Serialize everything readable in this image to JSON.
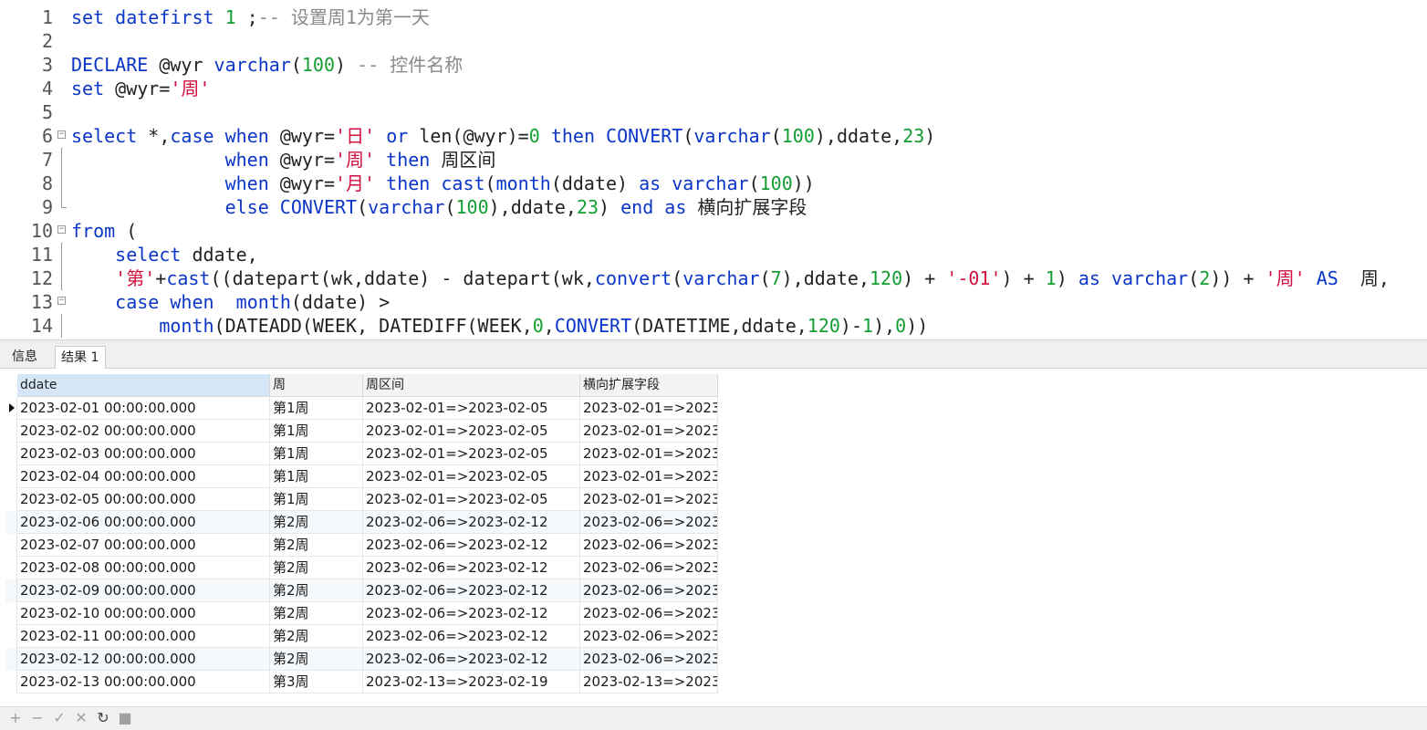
{
  "editor": {
    "lines": [
      {
        "num": "1",
        "fold": "",
        "tokens": [
          {
            "t": "set datefirst ",
            "c": "k"
          },
          {
            "t": "1",
            "c": "n"
          },
          {
            "t": " ;",
            "c": "p"
          },
          {
            "t": "-- 设置周1为第一天",
            "c": "c"
          }
        ]
      },
      {
        "num": "2",
        "fold": "",
        "tokens": []
      },
      {
        "num": "3",
        "fold": "",
        "tokens": [
          {
            "t": "DECLARE ",
            "c": "k"
          },
          {
            "t": "@wyr ",
            "c": "p"
          },
          {
            "t": "varchar",
            "c": "k"
          },
          {
            "t": "(",
            "c": "p"
          },
          {
            "t": "100",
            "c": "n"
          },
          {
            "t": ") ",
            "c": "p"
          },
          {
            "t": "-- 控件名称",
            "c": "c"
          }
        ]
      },
      {
        "num": "4",
        "fold": "",
        "tokens": [
          {
            "t": "set ",
            "c": "k"
          },
          {
            "t": "@wyr=",
            "c": "p"
          },
          {
            "t": "'周'",
            "c": "s"
          }
        ]
      },
      {
        "num": "5",
        "fold": "",
        "tokens": []
      },
      {
        "num": "6",
        "fold": "open",
        "tokens": [
          {
            "t": "select ",
            "c": "k"
          },
          {
            "t": "*,",
            "c": "p"
          },
          {
            "t": "case ",
            "c": "k"
          },
          {
            "t": "when ",
            "c": "k"
          },
          {
            "t": "@wyr=",
            "c": "p"
          },
          {
            "t": "'日'",
            "c": "s"
          },
          {
            "t": " ",
            "c": "p"
          },
          {
            "t": "or ",
            "c": "k"
          },
          {
            "t": "len(@wyr)=",
            "c": "p"
          },
          {
            "t": "0",
            "c": "n"
          },
          {
            "t": " ",
            "c": "p"
          },
          {
            "t": "then ",
            "c": "k"
          },
          {
            "t": "CONVERT",
            "c": "k"
          },
          {
            "t": "(",
            "c": "p"
          },
          {
            "t": "varchar",
            "c": "k"
          },
          {
            "t": "(",
            "c": "p"
          },
          {
            "t": "100",
            "c": "n"
          },
          {
            "t": "),ddate,",
            "c": "p"
          },
          {
            "t": "23",
            "c": "n"
          },
          {
            "t": ")",
            "c": "p"
          }
        ]
      },
      {
        "num": "7",
        "fold": "line",
        "tokens": [
          {
            "t": "              ",
            "c": "p"
          },
          {
            "t": "when ",
            "c": "k"
          },
          {
            "t": "@wyr=",
            "c": "p"
          },
          {
            "t": "'周'",
            "c": "s"
          },
          {
            "t": " ",
            "c": "p"
          },
          {
            "t": "then ",
            "c": "k"
          },
          {
            "t": "周区间",
            "c": "p"
          }
        ]
      },
      {
        "num": "8",
        "fold": "line",
        "tokens": [
          {
            "t": "              ",
            "c": "p"
          },
          {
            "t": "when ",
            "c": "k"
          },
          {
            "t": "@wyr=",
            "c": "p"
          },
          {
            "t": "'月'",
            "c": "s"
          },
          {
            "t": " ",
            "c": "p"
          },
          {
            "t": "then ",
            "c": "k"
          },
          {
            "t": "cast",
            "c": "k"
          },
          {
            "t": "(",
            "c": "p"
          },
          {
            "t": "month",
            "c": "k"
          },
          {
            "t": "(ddate) ",
            "c": "p"
          },
          {
            "t": "as ",
            "c": "k"
          },
          {
            "t": "varchar",
            "c": "k"
          },
          {
            "t": "(",
            "c": "p"
          },
          {
            "t": "100",
            "c": "n"
          },
          {
            "t": "))",
            "c": "p"
          }
        ]
      },
      {
        "num": "9",
        "fold": "end",
        "tokens": [
          {
            "t": "              ",
            "c": "p"
          },
          {
            "t": "else ",
            "c": "k"
          },
          {
            "t": "CONVERT",
            "c": "k"
          },
          {
            "t": "(",
            "c": "p"
          },
          {
            "t": "varchar",
            "c": "k"
          },
          {
            "t": "(",
            "c": "p"
          },
          {
            "t": "100",
            "c": "n"
          },
          {
            "t": "),ddate,",
            "c": "p"
          },
          {
            "t": "23",
            "c": "n"
          },
          {
            "t": ") ",
            "c": "p"
          },
          {
            "t": "end ",
            "c": "k"
          },
          {
            "t": "as ",
            "c": "k"
          },
          {
            "t": "横向扩展字段",
            "c": "p"
          }
        ]
      },
      {
        "num": "10",
        "fold": "open",
        "tokens": [
          {
            "t": "from ",
            "c": "k"
          },
          {
            "t": "(",
            "c": "p"
          }
        ]
      },
      {
        "num": "11",
        "fold": "line",
        "tokens": [
          {
            "t": "    ",
            "c": "p"
          },
          {
            "t": "select ",
            "c": "k"
          },
          {
            "t": "ddate,",
            "c": "p"
          }
        ]
      },
      {
        "num": "12",
        "fold": "line",
        "tokens": [
          {
            "t": "    ",
            "c": "p"
          },
          {
            "t": "'第'",
            "c": "s"
          },
          {
            "t": "+",
            "c": "p"
          },
          {
            "t": "cast",
            "c": "k"
          },
          {
            "t": "((datepart(wk,ddate) - datepart(wk,",
            "c": "p"
          },
          {
            "t": "convert",
            "c": "k"
          },
          {
            "t": "(",
            "c": "p"
          },
          {
            "t": "varchar",
            "c": "k"
          },
          {
            "t": "(",
            "c": "p"
          },
          {
            "t": "7",
            "c": "n"
          },
          {
            "t": "),ddate,",
            "c": "p"
          },
          {
            "t": "120",
            "c": "n"
          },
          {
            "t": ") + ",
            "c": "p"
          },
          {
            "t": "'-01'",
            "c": "s"
          },
          {
            "t": ") + ",
            "c": "p"
          },
          {
            "t": "1",
            "c": "n"
          },
          {
            "t": ") ",
            "c": "p"
          },
          {
            "t": "as ",
            "c": "k"
          },
          {
            "t": "varchar",
            "c": "k"
          },
          {
            "t": "(",
            "c": "p"
          },
          {
            "t": "2",
            "c": "n"
          },
          {
            "t": ")) + ",
            "c": "p"
          },
          {
            "t": "'周'",
            "c": "s"
          },
          {
            "t": " ",
            "c": "p"
          },
          {
            "t": "AS",
            "c": "k"
          },
          {
            "t": "  周,",
            "c": "p"
          }
        ]
      },
      {
        "num": "13",
        "fold": "open",
        "tokens": [
          {
            "t": "    ",
            "c": "p"
          },
          {
            "t": "case ",
            "c": "k"
          },
          {
            "t": "when ",
            "c": "k"
          },
          {
            "t": " ",
            "c": "p"
          },
          {
            "t": "month",
            "c": "k"
          },
          {
            "t": "(ddate) >",
            "c": "p"
          }
        ]
      },
      {
        "num": "14",
        "fold": "line",
        "tokens": [
          {
            "t": "        ",
            "c": "p"
          },
          {
            "t": "month",
            "c": "k"
          },
          {
            "t": "(DATEADD(WEEK, DATEDIFF(WEEK,",
            "c": "p"
          },
          {
            "t": "0",
            "c": "n"
          },
          {
            "t": ",",
            "c": "p"
          },
          {
            "t": "CONVERT",
            "c": "k"
          },
          {
            "t": "(DATETIME,ddate,",
            "c": "p"
          },
          {
            "t": "120",
            "c": "n"
          },
          {
            "t": ")-",
            "c": "p"
          },
          {
            "t": "1",
            "c": "n"
          },
          {
            "t": "),",
            "c": "p"
          },
          {
            "t": "0",
            "c": "n"
          },
          {
            "t": "))",
            "c": "p"
          }
        ]
      }
    ]
  },
  "tabs": {
    "info": "信息",
    "result": "结果 1"
  },
  "grid": {
    "columns": [
      "ddate",
      "周",
      "周区间",
      "横向扩展字段"
    ],
    "rows": [
      [
        "2023-02-01 00:00:00.000",
        "第1周",
        "2023-02-01=>2023-02-05",
        "2023-02-01=>2023-"
      ],
      [
        "2023-02-02 00:00:00.000",
        "第1周",
        "2023-02-01=>2023-02-05",
        "2023-02-01=>2023-"
      ],
      [
        "2023-02-03 00:00:00.000",
        "第1周",
        "2023-02-01=>2023-02-05",
        "2023-02-01=>2023-"
      ],
      [
        "2023-02-04 00:00:00.000",
        "第1周",
        "2023-02-01=>2023-02-05",
        "2023-02-01=>2023-"
      ],
      [
        "2023-02-05 00:00:00.000",
        "第1周",
        "2023-02-01=>2023-02-05",
        "2023-02-01=>2023-"
      ],
      [
        "2023-02-06 00:00:00.000",
        "第2周",
        "2023-02-06=>2023-02-12",
        "2023-02-06=>2023-"
      ],
      [
        "2023-02-07 00:00:00.000",
        "第2周",
        "2023-02-06=>2023-02-12",
        "2023-02-06=>2023-"
      ],
      [
        "2023-02-08 00:00:00.000",
        "第2周",
        "2023-02-06=>2023-02-12",
        "2023-02-06=>2023-"
      ],
      [
        "2023-02-09 00:00:00.000",
        "第2周",
        "2023-02-06=>2023-02-12",
        "2023-02-06=>2023-"
      ],
      [
        "2023-02-10 00:00:00.000",
        "第2周",
        "2023-02-06=>2023-02-12",
        "2023-02-06=>2023-"
      ],
      [
        "2023-02-11 00:00:00.000",
        "第2周",
        "2023-02-06=>2023-02-12",
        "2023-02-06=>2023-"
      ],
      [
        "2023-02-12 00:00:00.000",
        "第2周",
        "2023-02-06=>2023-02-12",
        "2023-02-06=>2023-"
      ],
      [
        "2023-02-13 00:00:00.000",
        "第3周",
        "2023-02-13=>2023-02-19",
        "2023-02-13=>2023-"
      ]
    ]
  },
  "toolbar": {
    "buttons": [
      {
        "name": "add-record-icon",
        "glyph": "+"
      },
      {
        "name": "delete-record-icon",
        "glyph": "−"
      },
      {
        "name": "apply-changes-icon",
        "glyph": "✓"
      },
      {
        "name": "discard-changes-icon",
        "glyph": "✕"
      },
      {
        "name": "refresh-icon",
        "glyph": "↻"
      },
      {
        "name": "stop-icon",
        "glyph": "■"
      }
    ]
  }
}
